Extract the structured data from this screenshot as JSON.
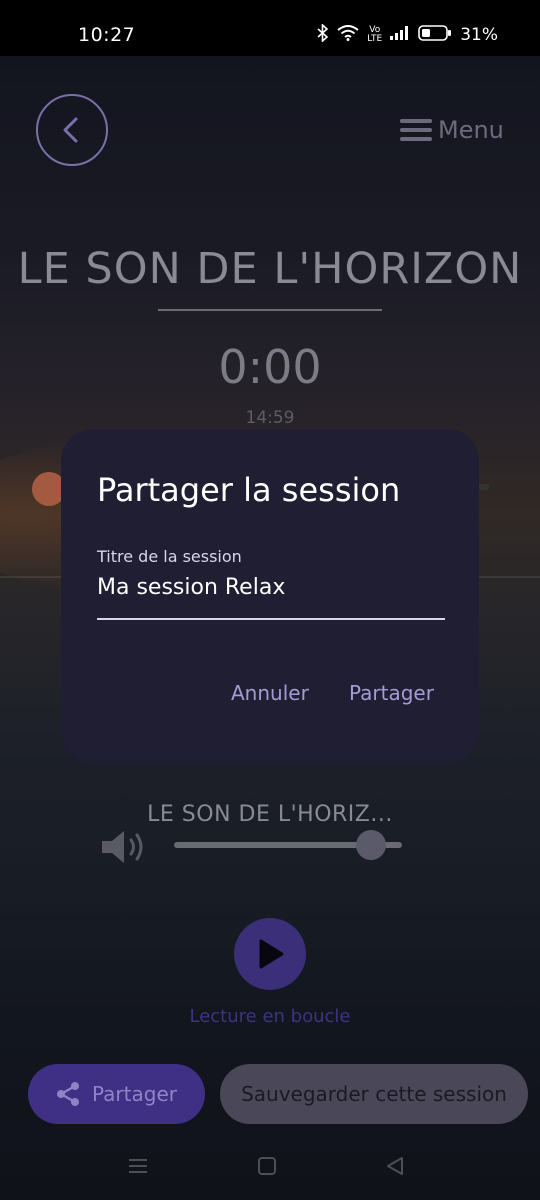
{
  "status_bar": {
    "time": "10:27",
    "volte_top": "Vo",
    "volte_bottom": "LTE",
    "battery_percent": "31%"
  },
  "header": {
    "menu_label": "Menu"
  },
  "player": {
    "title": "LE SON DE L'HORIZON",
    "elapsed": "0:00",
    "duration": "14:59",
    "track_name": "LE SON DE L'HORIZ...",
    "loop_label": "Lecture en boucle"
  },
  "actions": {
    "share_label": "Partager",
    "save_label": "Sauvegarder cette session"
  },
  "dialog": {
    "title": "Partager la session",
    "field_label": "Titre de la session",
    "field_value": "Ma session Relax",
    "cancel_label": "Annuler",
    "confirm_label": "Partager"
  },
  "colors": {
    "accent": "#3f2f85",
    "dialog_bg": "#201e32",
    "dialog_action": "#a59ad6"
  },
  "icons": [
    "back-arrow-icon",
    "menu-icon",
    "speaker-icon",
    "play-icon",
    "share-icon",
    "nav-recents-icon",
    "nav-home-icon",
    "nav-back-icon"
  ]
}
